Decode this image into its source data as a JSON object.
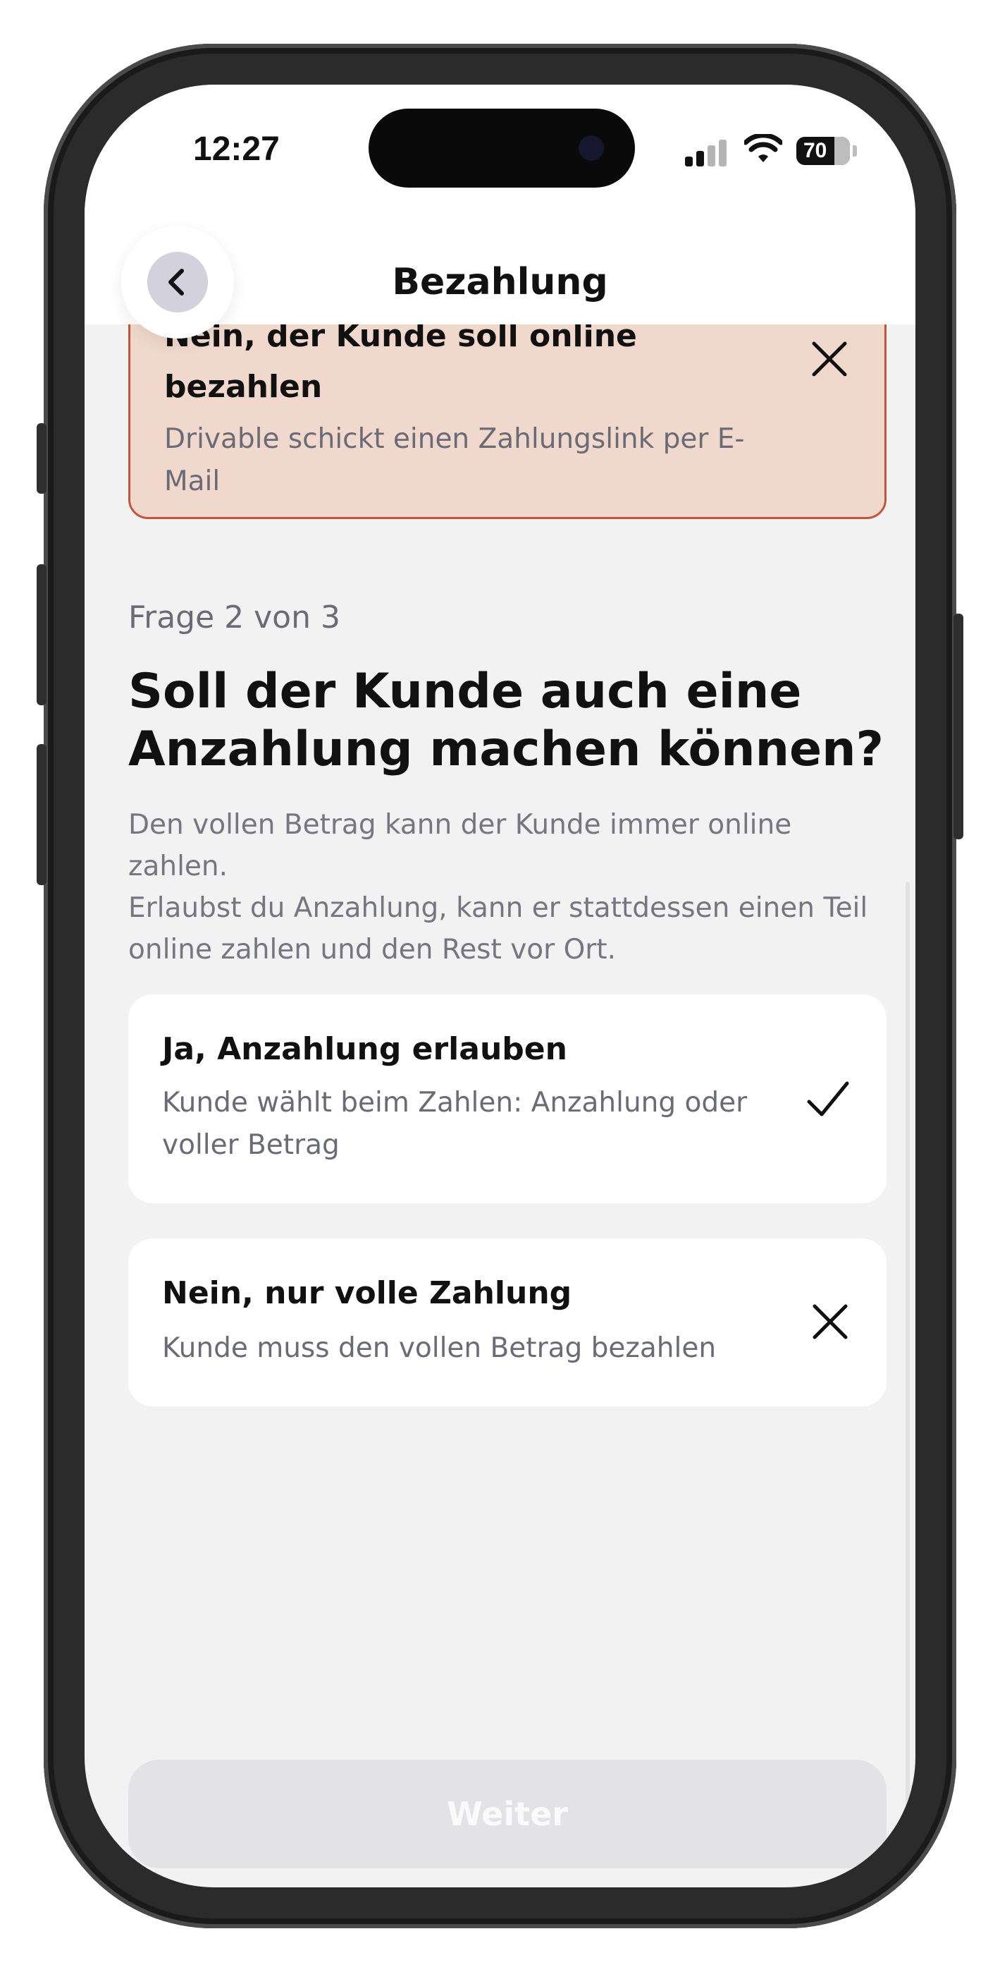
{
  "status_bar": {
    "time": "12:27",
    "battery": "70"
  },
  "header": {
    "title": "Bezahlung"
  },
  "previous_answer": {
    "title": "Nein, der Kunde soll online bezahlen",
    "subtitle": "Drivable schickt einen Zahlungslink per E-Mail",
    "icon": "close-icon"
  },
  "question": {
    "counter": "Frage 2 von 3",
    "title": "Soll der Kunde auch eine Anzahlung machen können?",
    "description_line1": "Den vollen Betrag kann der Kunde immer online zahlen.",
    "description_line2": "Erlaubst du Anzahlung, kann er stattdessen einen Teil online zahlen und den Rest vor Ort."
  },
  "options": [
    {
      "title": "Ja, Anzahlung erlauben",
      "subtitle": "Kunde wählt beim Zahlen: Anzahlung oder voller Betrag",
      "icon": "check-icon"
    },
    {
      "title": "Nein, nur volle Zahlung",
      "subtitle": "Kunde muss den vollen Betrag bezahlen",
      "icon": "close-icon"
    }
  ],
  "footer": {
    "next_label": "Weiter"
  },
  "colors": {
    "previous_card_bg": "#f0d9cc",
    "previous_card_border": "#c0573a",
    "screen_bg": "#f2f2f2",
    "disabled_button_bg": "#e3e3e6"
  }
}
